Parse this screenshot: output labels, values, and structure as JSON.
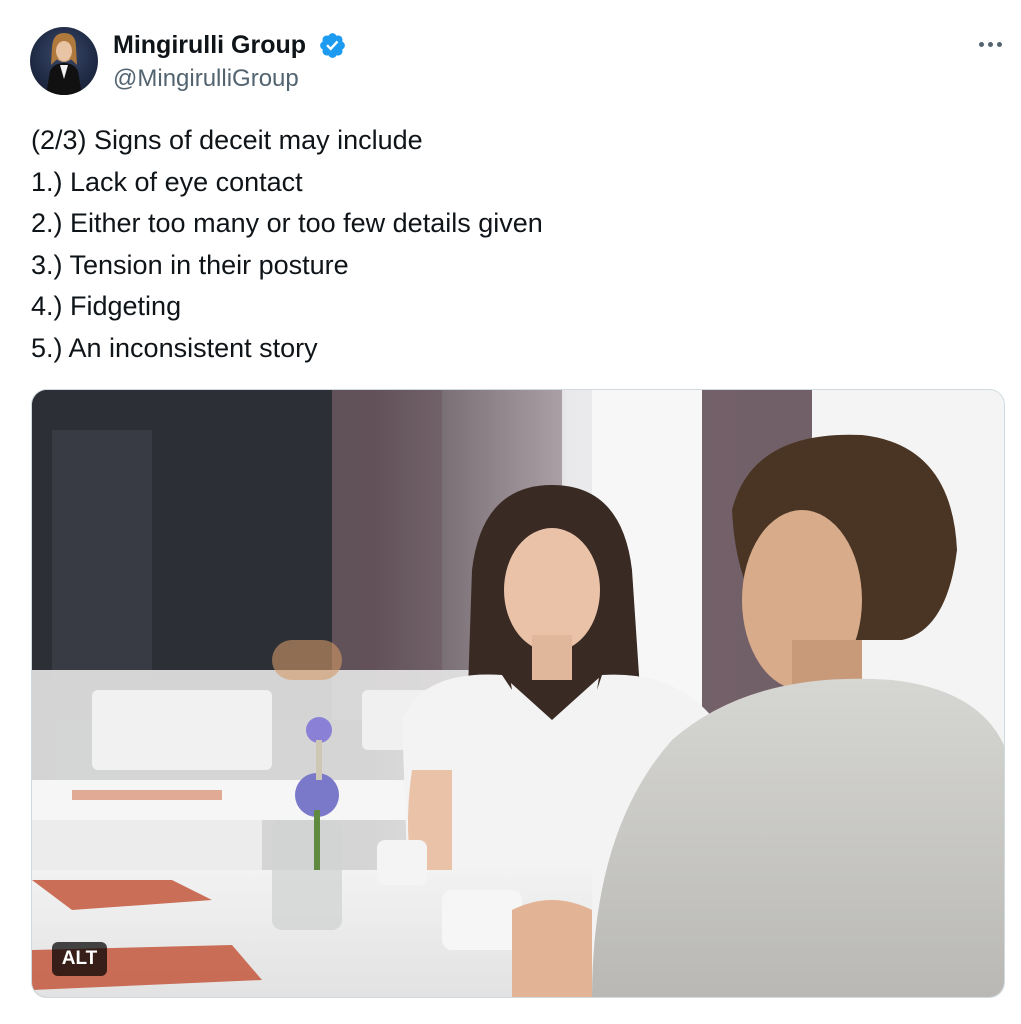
{
  "author": {
    "display_name": "Mingirulli Group",
    "handle": "@MingirulliGroup",
    "verified_icon": "verified-badge-icon",
    "avatar": "profile-photo"
  },
  "menu": {
    "more_icon": "more-horizontal-icon"
  },
  "tweet": {
    "lines": [
      "(2/3) Signs of deceit may include",
      "1.) Lack of eye contact",
      "2.) Either too many or too few details given",
      "3.) Tension in their posture",
      "4.) Fidgeting",
      "5.) An inconsistent story"
    ]
  },
  "media": {
    "alt_label": "ALT"
  },
  "colors": {
    "text": "#0f1419",
    "secondary_text": "#536471",
    "verified_blue": "#1d9bf0",
    "border": "#cfd9de"
  }
}
